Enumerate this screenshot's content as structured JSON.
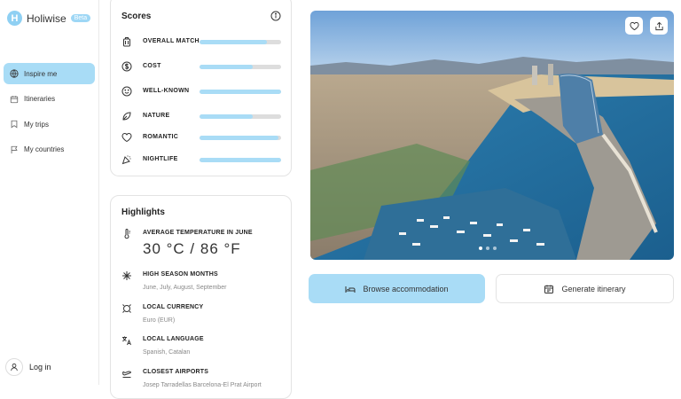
{
  "app": {
    "name": "Holiwise",
    "badge": "Beta"
  },
  "sidebar": {
    "items": [
      {
        "label": "Inspire me",
        "active": true
      },
      {
        "label": "Itineraries"
      },
      {
        "label": "My trips"
      },
      {
        "label": "My countries"
      }
    ],
    "login_label": "Log in"
  },
  "scores": {
    "title": "Scores",
    "rows": [
      {
        "label": "OVERALL MATCH",
        "value": 0.83
      },
      {
        "label": "COST",
        "value": 0.65
      },
      {
        "label": "WELL-KNOWN",
        "value": 1.0
      },
      {
        "label": "NATURE",
        "value": 0.65
      },
      {
        "label": "ROMANTIC",
        "value": 0.97
      },
      {
        "label": "NIGHTLIFE",
        "value": 1.0
      }
    ]
  },
  "highlights": {
    "title": "Highlights",
    "temp_label": "AVERAGE TEMPERATURE IN JUNE",
    "temp_value": "30 °C / 86 °F",
    "season_label": "HIGH SEASON MONTHS",
    "season_value": "June, July, August, September",
    "currency_label": "LOCAL CURRENCY",
    "currency_value": "Euro (EUR)",
    "language_label": "LOCAL LANGUAGE",
    "language_value": "Spanish, Catalan",
    "airports_label": "CLOSEST AIRPORTS",
    "airports_value": "Josep Tarradellas Barcelona-El Prat Airport"
  },
  "actions": {
    "browse_label": "Browse accommodation",
    "itinerary_label": "Generate itinerary"
  },
  "colors": {
    "accent": "#a9dcf6",
    "bar_empty": "#dddddd"
  }
}
